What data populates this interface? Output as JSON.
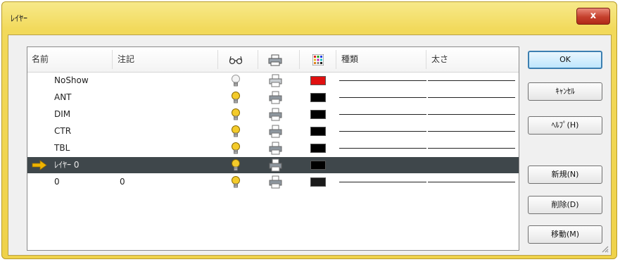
{
  "window": {
    "title": "ﾚｲﾔｰ",
    "close_label": "x"
  },
  "columns": {
    "name": "名前",
    "comment": "注記",
    "linetype": "種類",
    "lineweight": "太さ"
  },
  "layers": [
    {
      "name": "NoShow",
      "comment": "",
      "color": "#e01010",
      "on": false,
      "current": false
    },
    {
      "name": "ANT",
      "comment": "",
      "color": "#000000",
      "on": true,
      "current": false
    },
    {
      "name": "DIM",
      "comment": "",
      "color": "#000000",
      "on": true,
      "current": false
    },
    {
      "name": "CTR",
      "comment": "",
      "color": "#000000",
      "on": true,
      "current": false
    },
    {
      "name": "TBL",
      "comment": "",
      "color": "#000000",
      "on": true,
      "current": false
    },
    {
      "name": "ﾚｲﾔｰ 0",
      "comment": "",
      "color": "#000000",
      "on": true,
      "current": true
    },
    {
      "name": "0",
      "comment": "0",
      "color": "#1a1a1a",
      "on": true,
      "current": false
    }
  ],
  "buttons": {
    "ok": "OK",
    "cancel": "ｷｬﾝｾﾙ",
    "help": "ﾍﾙﾌﾟ(H)",
    "new": "新規(N)",
    "delete": "削除(D)",
    "move": "移動(M)"
  },
  "icons": {
    "on_off": "lightbulb-icon",
    "print": "printer-icon",
    "color": "color-palette-icon"
  }
}
